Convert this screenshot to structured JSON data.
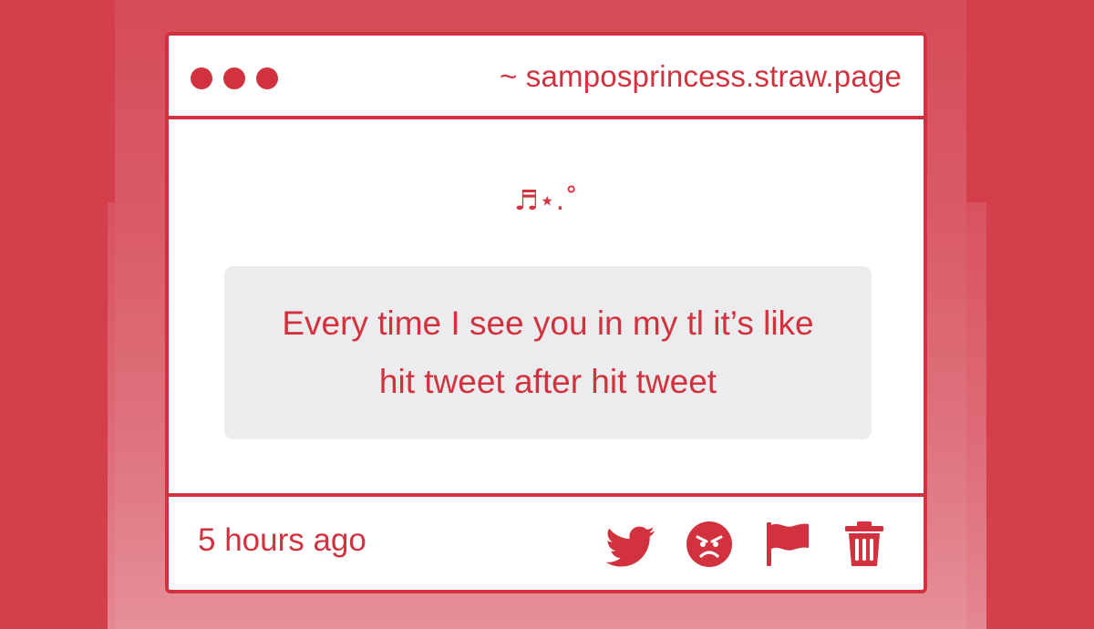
{
  "window": {
    "url": "~ samposprincess.straw.page",
    "controls": [
      "close",
      "minimize",
      "maximize"
    ]
  },
  "post": {
    "decoration": "♬⋆.˚",
    "message": "Every time I see you in my tl it’s like hit tweet after hit tweet",
    "timestamp": "5 hours ago"
  },
  "actions": [
    {
      "name": "twitter-share",
      "icon": "twitter-bird-icon"
    },
    {
      "name": "react-angry",
      "icon": "angry-face-icon"
    },
    {
      "name": "report",
      "icon": "flag-icon"
    },
    {
      "name": "delete",
      "icon": "trash-icon"
    }
  ],
  "colors": {
    "accent": "#d1323e",
    "background": "#d3404c",
    "bubble": "#ececee",
    "window": "#ffffff"
  }
}
